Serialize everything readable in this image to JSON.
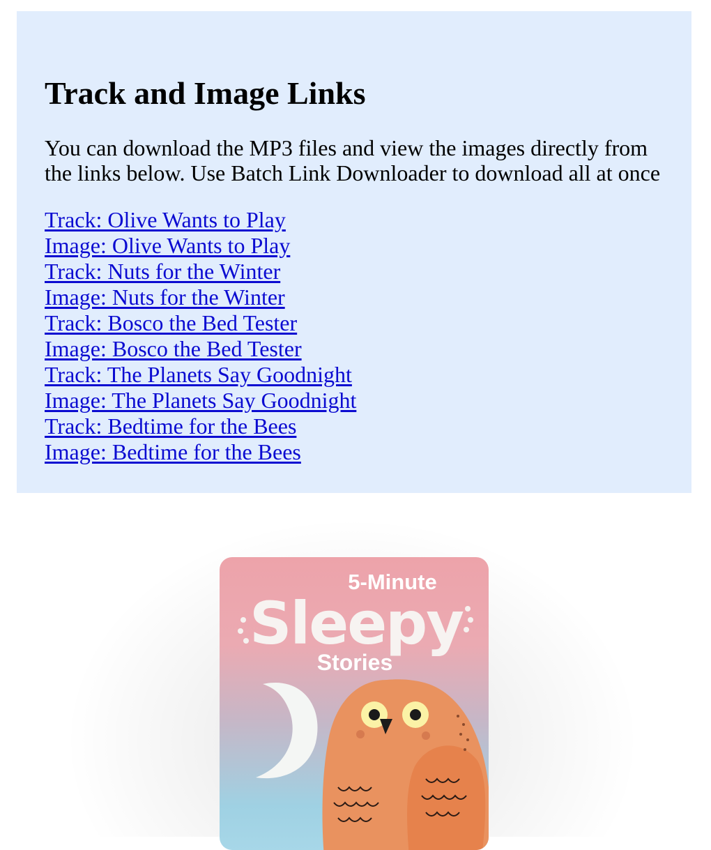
{
  "header": {
    "title": "Track and Image Links",
    "description": "You can download the MP3 files and view the images directly from the links below. Use Batch Link Downloader to download all at once"
  },
  "links": [
    {
      "label": "Track: Olive Wants to Play"
    },
    {
      "label": "Image: Olive Wants to Play"
    },
    {
      "label": "Track: Nuts for the Winter"
    },
    {
      "label": "Image: Nuts for the Winter"
    },
    {
      "label": "Track: Bosco the Bed Tester"
    },
    {
      "label": "Image: Bosco the Bed Tester"
    },
    {
      "label": "Track: The Planets Say Goodnight"
    },
    {
      "label": "Image: The Planets Say Goodnight"
    },
    {
      "label": "Track: Bedtime for the Bees"
    },
    {
      "label": "Image: Bedtime for the Bees"
    }
  ],
  "cover": {
    "line1": "5-Minute",
    "line2": "Sleepy",
    "line3": "Stories",
    "icons": [
      "moon-icon",
      "owl-illustration"
    ]
  },
  "colors": {
    "panel_bg": "#e1edfd",
    "link": "#0b0bd1",
    "cover_top": "#eda3aa",
    "cover_bottom": "#a7d7e8",
    "owl": "#e9925f"
  }
}
